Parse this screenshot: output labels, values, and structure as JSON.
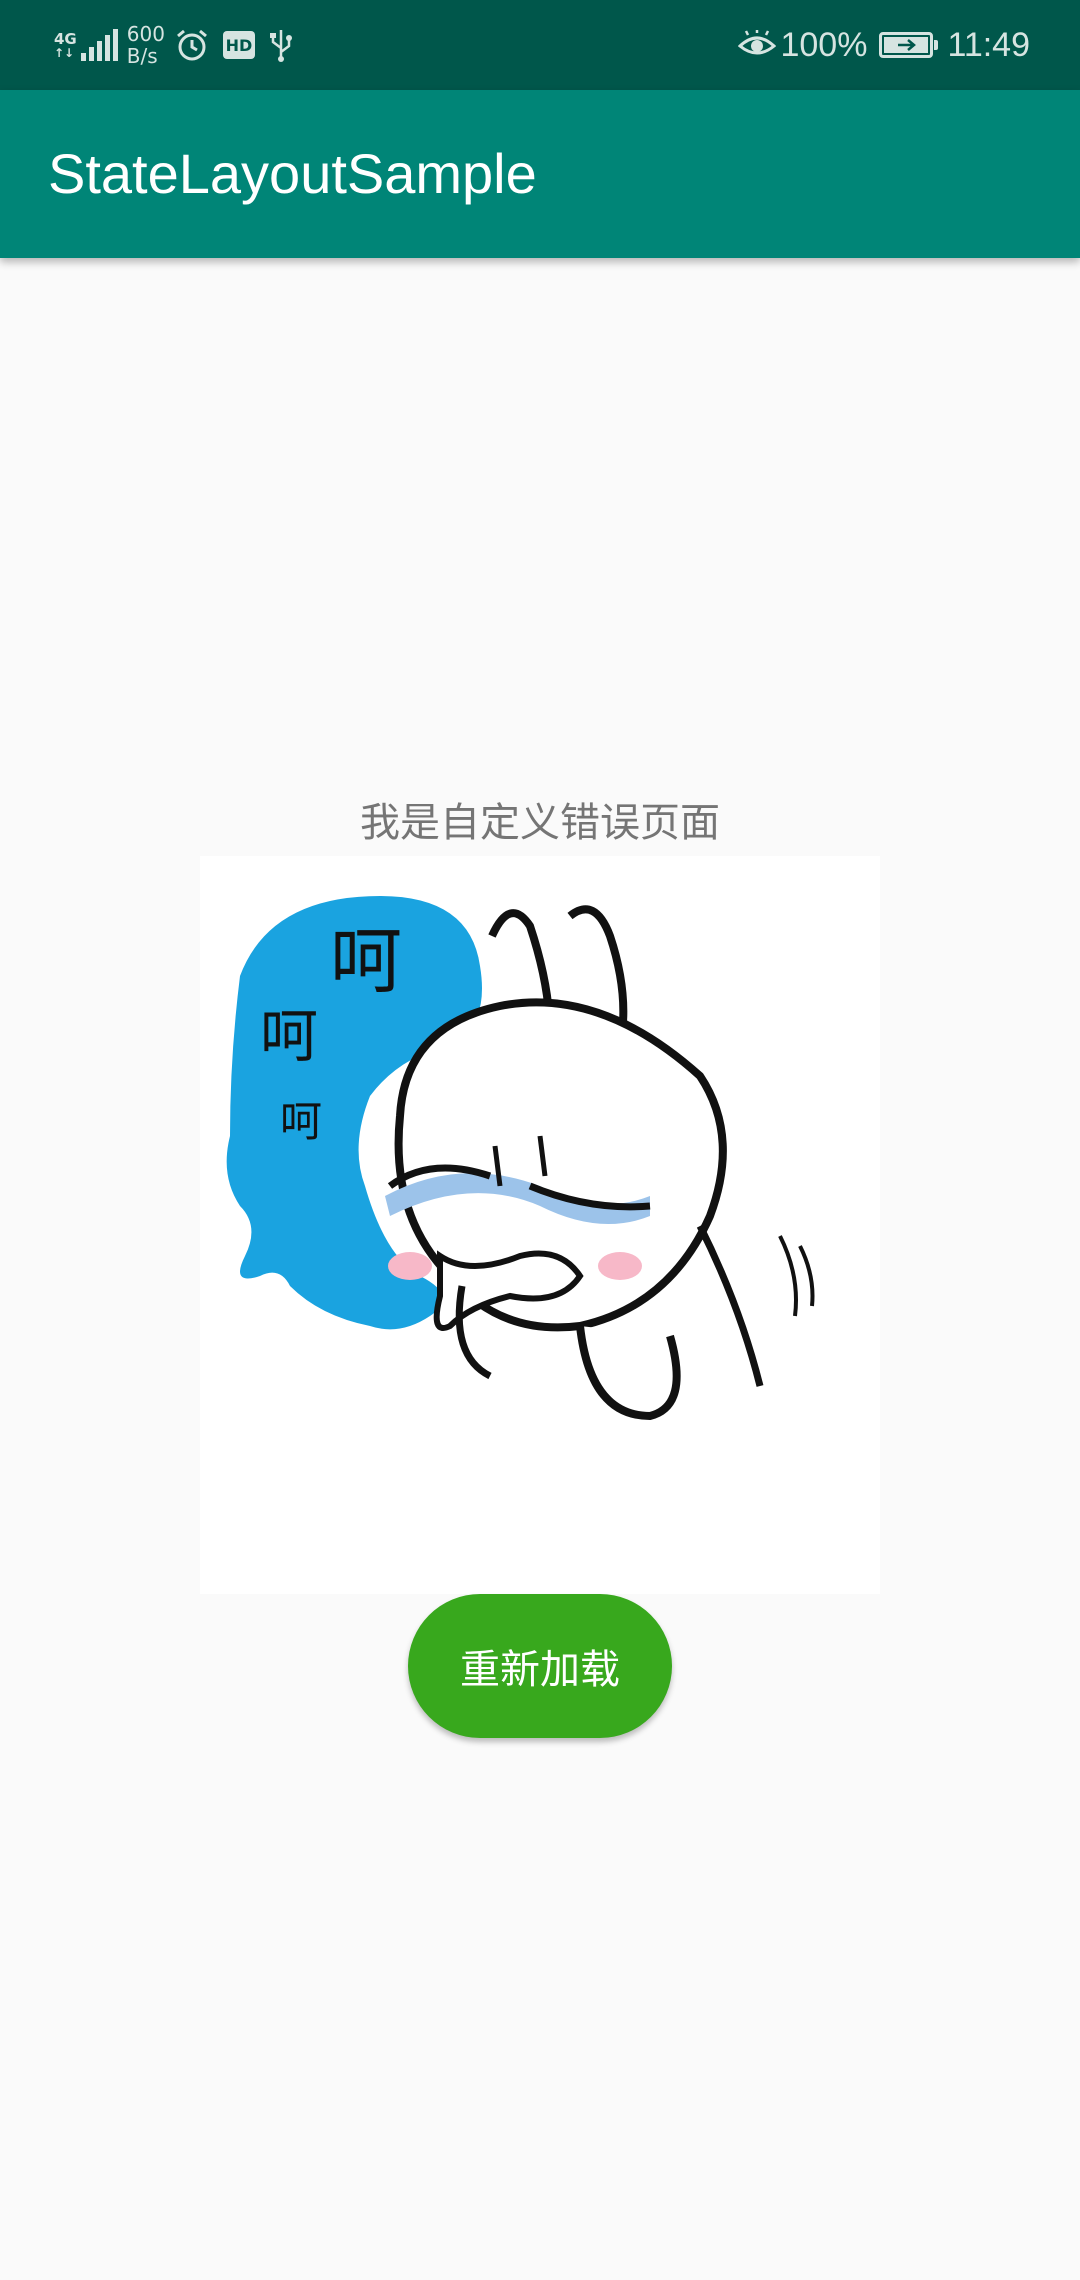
{
  "status_bar": {
    "network_type": "4G",
    "net_speed_value": "600",
    "net_speed_unit": "B/s",
    "hd_label": "HD",
    "battery_percent": "100%",
    "time": "11:49",
    "icons": [
      "signal-icon",
      "alarm-icon",
      "hd-icon",
      "usb-icon",
      "eye-comfort-icon",
      "battery-icon"
    ]
  },
  "app_bar": {
    "title": "StateLayoutSample",
    "color": "#008577"
  },
  "error_page": {
    "message": "我是自定义错误页面",
    "image": {
      "speech_text": [
        "呵",
        "呵",
        "呵"
      ]
    },
    "reload_label": "重新加载",
    "button_color": "#38a81d"
  },
  "colors": {
    "status_bar": "#00574b",
    "background": "#fafafa"
  }
}
